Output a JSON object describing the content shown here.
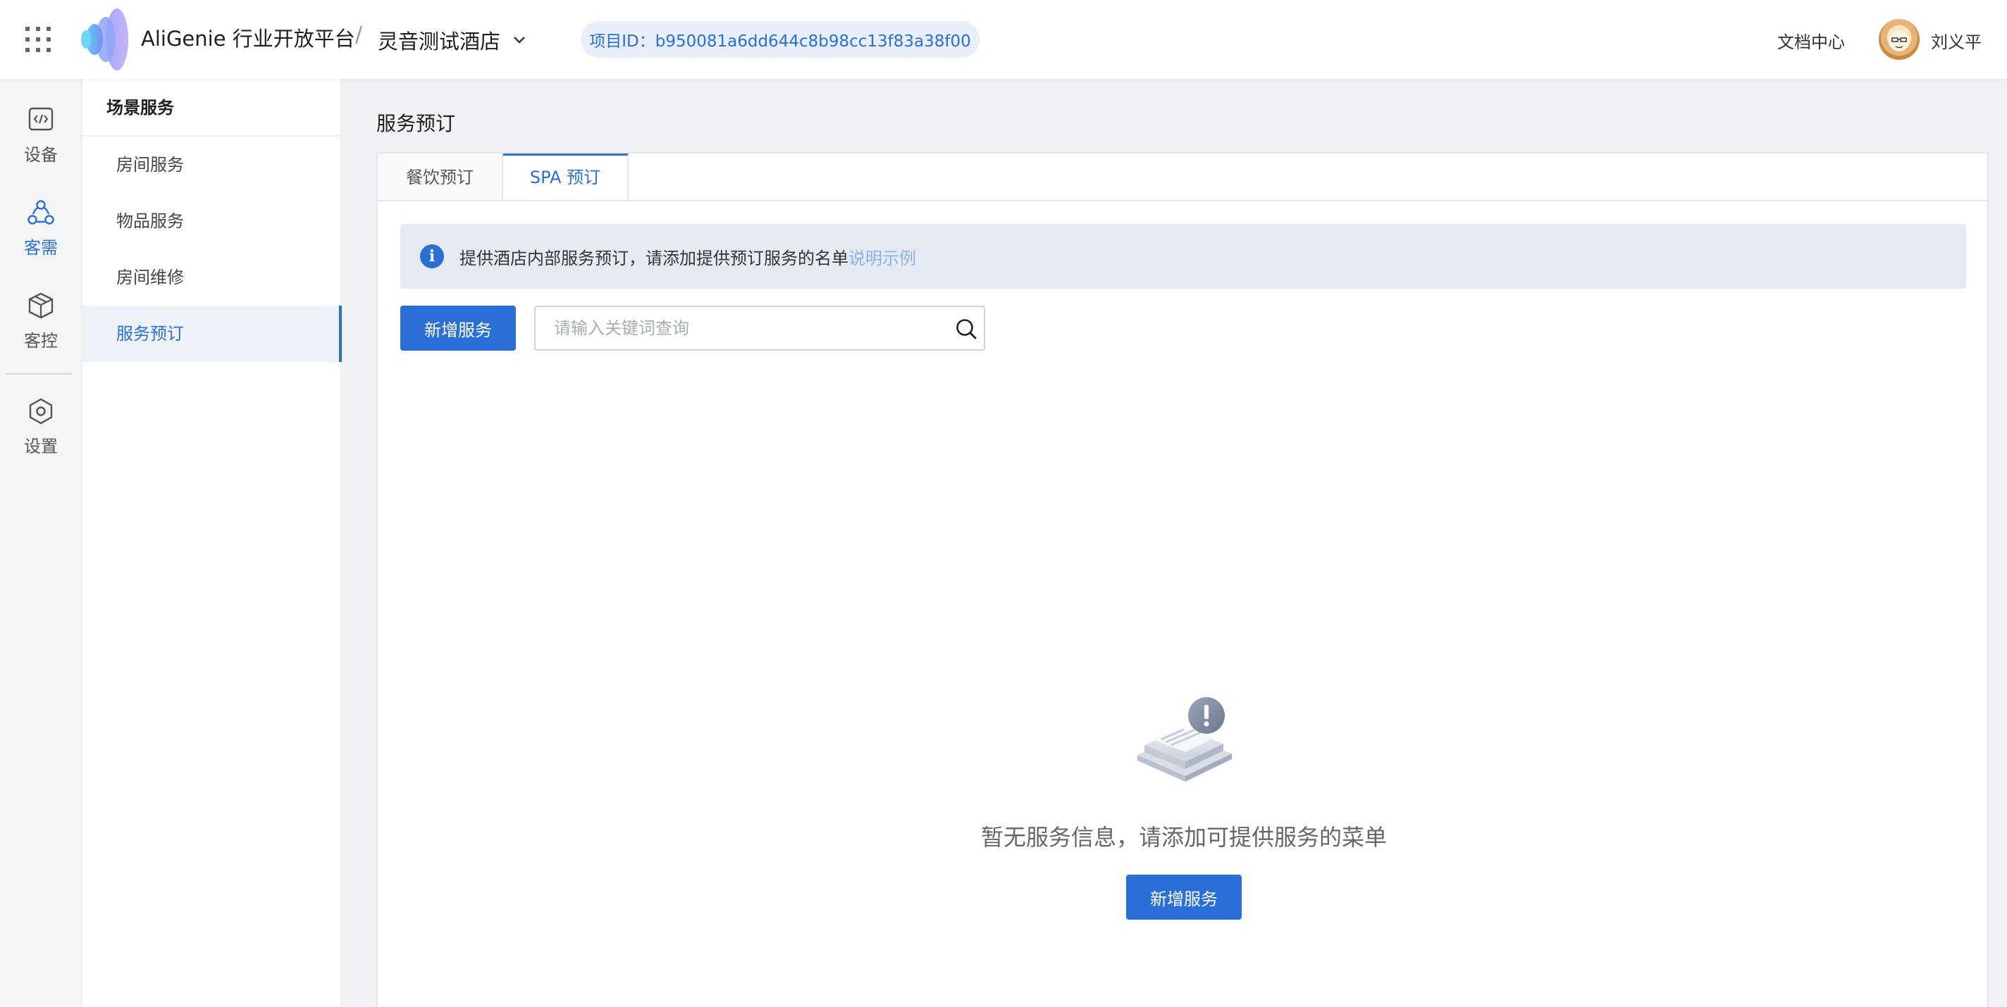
{
  "header": {
    "brand": "AliGenie 行业开放平台",
    "separator": "/",
    "hotel_name": "灵音测试酒店",
    "project_id": "项目ID：b950081a6dd644c8b98cc13f83a38f00",
    "doc_center": "文档中心",
    "user_name": "刘义平"
  },
  "rail": {
    "items": [
      {
        "label": "设备",
        "icon": "code-device-icon"
      },
      {
        "label": "客需",
        "icon": "guest-needs-icon"
      },
      {
        "label": "客控",
        "icon": "cube-control-icon"
      },
      {
        "label": "设置",
        "icon": "settings-hex-icon"
      }
    ],
    "active_index": 1
  },
  "subnav": {
    "title": "场景服务",
    "items": [
      {
        "label": "房间服务"
      },
      {
        "label": "物品服务"
      },
      {
        "label": "房间维修"
      },
      {
        "label": "服务预订"
      }
    ],
    "active_index": 3
  },
  "main": {
    "page_title": "服务预订",
    "tabs": [
      {
        "label": "餐饮预订"
      },
      {
        "label": "SPA 预订"
      }
    ],
    "active_tab": 1,
    "notice": {
      "text": "提供酒店内部服务预订，请添加提供预订服务的名单",
      "link": "说明示例"
    },
    "add_button": "新增服务",
    "search_placeholder": "请输入关键词查询",
    "empty": {
      "text": "暂无服务信息，请添加可提供服务的菜单",
      "button": "新增服务"
    }
  },
  "colors": {
    "accent": "#2a6fd6",
    "notice_bg": "#e6ebf3",
    "page_bg": "#f0f2f5"
  }
}
